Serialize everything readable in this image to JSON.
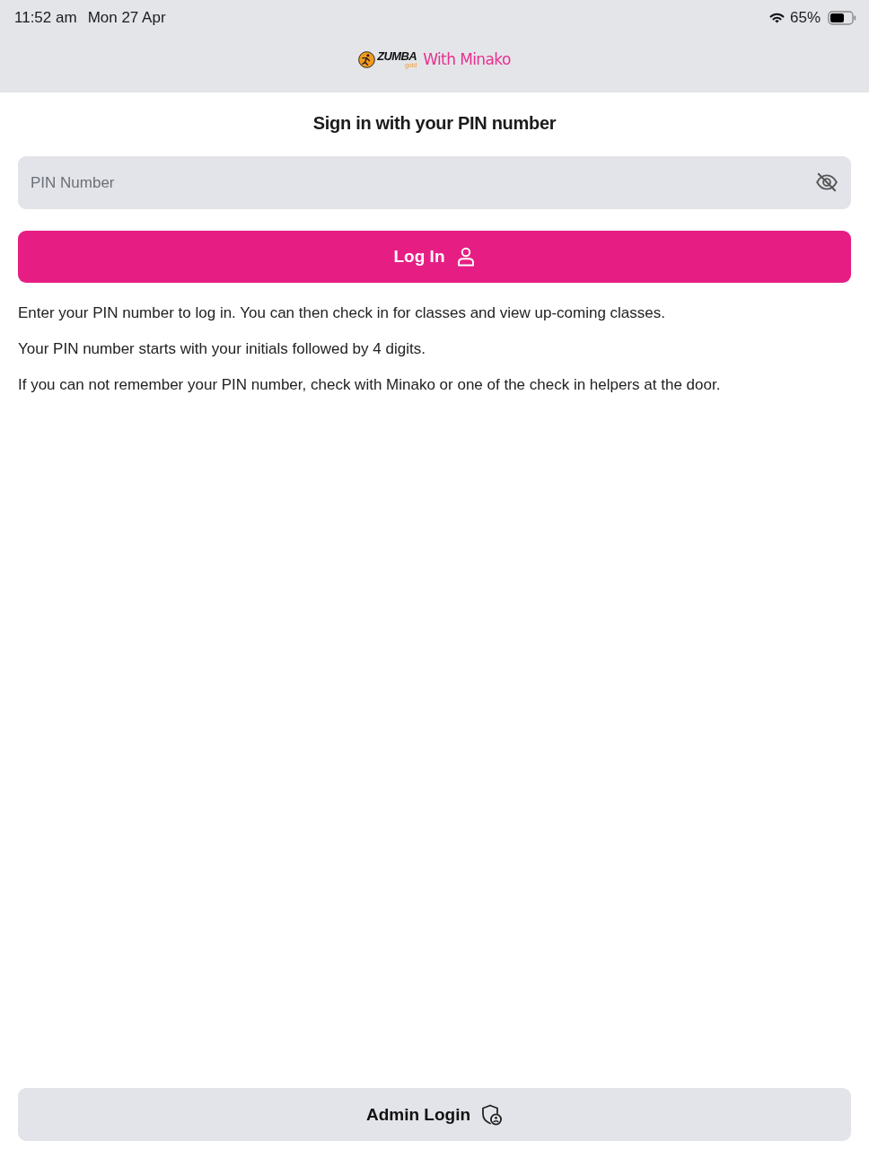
{
  "status_bar": {
    "time": "11:52 am",
    "date": "Mon 27 Apr",
    "battery": "65%"
  },
  "header": {
    "logo": {
      "brand": "ZUMBA",
      "sub": "gold",
      "tagline": "With Minako"
    }
  },
  "title": "Sign in with your PIN number",
  "pin_field": {
    "placeholder": "PIN Number"
  },
  "login_button": {
    "label": "Log In"
  },
  "info": [
    "Enter your PIN number to log in. You can then check in for classes and view up-coming classes.",
    "Your PIN number starts with your initials followed by 4 digits.",
    "If you can not remember your PIN number, check with Minako or one of the check in helpers at the door."
  ],
  "admin_button": {
    "label": "Admin Login"
  }
}
